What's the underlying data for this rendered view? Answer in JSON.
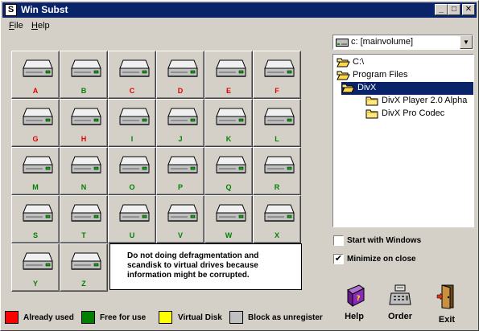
{
  "window": {
    "title": "Win Subst",
    "app_icon": "S",
    "min_glyph": "_",
    "max_glyph": "□",
    "close_glyph": "✕"
  },
  "menu": [
    {
      "label": "File"
    },
    {
      "label": "Help"
    }
  ],
  "drives": [
    {
      "letter": "A",
      "color": "#e00000"
    },
    {
      "letter": "B",
      "color": "#008000"
    },
    {
      "letter": "C",
      "color": "#e00000"
    },
    {
      "letter": "D",
      "color": "#e00000"
    },
    {
      "letter": "E",
      "color": "#e00000"
    },
    {
      "letter": "F",
      "color": "#e00000"
    },
    {
      "letter": "G",
      "color": "#e00000"
    },
    {
      "letter": "H",
      "color": "#e00000"
    },
    {
      "letter": "I",
      "color": "#008000"
    },
    {
      "letter": "J",
      "color": "#008000"
    },
    {
      "letter": "K",
      "color": "#008000"
    },
    {
      "letter": "L",
      "color": "#008000"
    },
    {
      "letter": "M",
      "color": "#008000"
    },
    {
      "letter": "N",
      "color": "#008000"
    },
    {
      "letter": "O",
      "color": "#008000"
    },
    {
      "letter": "P",
      "color": "#008000"
    },
    {
      "letter": "Q",
      "color": "#008000"
    },
    {
      "letter": "R",
      "color": "#008000"
    },
    {
      "letter": "S",
      "color": "#008000"
    },
    {
      "letter": "T",
      "color": "#008000"
    },
    {
      "letter": "U",
      "color": "#008000"
    },
    {
      "letter": "V",
      "color": "#008000"
    },
    {
      "letter": "W",
      "color": "#008000"
    },
    {
      "letter": "X",
      "color": "#008000"
    },
    {
      "letter": "Y",
      "color": "#008000"
    },
    {
      "letter": "Z",
      "color": "#008000"
    }
  ],
  "notice": "Do not doing defragmentation and scandisk to virtual drives because information might be corrupted.",
  "drive_select": {
    "value": "c: [mainvolume]",
    "icon": "drive-icon"
  },
  "tree": [
    {
      "label": "C:\\",
      "icon": "open-folder-icon",
      "selected": false
    },
    {
      "label": "Program Files",
      "icon": "open-folder-icon",
      "selected": false
    },
    {
      "label": "DivX",
      "icon": "open-folder-icon",
      "selected": true
    },
    {
      "label": "DivX Player 2.0 Alpha",
      "icon": "folder-icon",
      "selected": false
    },
    {
      "label": "DivX Pro Codec",
      "icon": "folder-icon",
      "selected": false
    }
  ],
  "options": {
    "start_with_windows": {
      "label": "Start with Windows",
      "checked": false
    },
    "minimize_on_close": {
      "label": "Minimize on close",
      "checked": true
    },
    "check_glyph": "✔"
  },
  "legend": [
    {
      "label": "Already used",
      "color": "#ff0000"
    },
    {
      "label": "Free for use",
      "color": "#008000"
    },
    {
      "label": "Virtual Disk",
      "color": "#ffff00"
    },
    {
      "label": "Block as unregister",
      "color": "#c0c0c0"
    }
  ],
  "actions": {
    "help": {
      "label": "Help",
      "icon": "help-book-icon"
    },
    "order": {
      "label": "Order",
      "icon": "cash-register-icon"
    },
    "exit": {
      "label": "Exit",
      "icon": "exit-door-icon"
    }
  }
}
